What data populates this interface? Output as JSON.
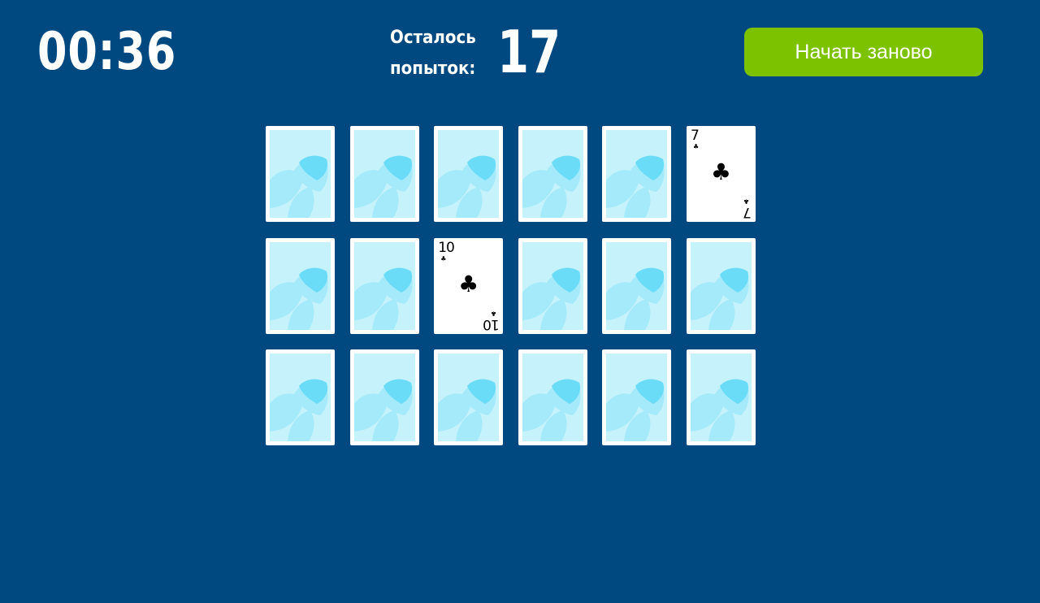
{
  "header": {
    "timer": "00:36",
    "attempts_label": "Осталось попыток:",
    "attempts_count": "17",
    "restart_label": "Начать заново"
  },
  "colors": {
    "background": "#004980",
    "button": "#7dc200",
    "card_back": "#c5f2fb",
    "card_back_leaf_light": "#a4eafa",
    "card_back_leaf_dark": "#6bdcf8"
  },
  "board": {
    "rows": 3,
    "columns": 6,
    "cards": [
      {
        "state": "back",
        "icon": "leaf-pattern-icon"
      },
      {
        "state": "back",
        "icon": "leaf-pattern-icon"
      },
      {
        "state": "back",
        "icon": "leaf-pattern-icon"
      },
      {
        "state": "back",
        "icon": "leaf-pattern-icon"
      },
      {
        "state": "back",
        "icon": "leaf-pattern-icon"
      },
      {
        "state": "face",
        "rank": "7",
        "suit": "♣",
        "suit_name": "clubs-icon"
      },
      {
        "state": "back",
        "icon": "leaf-pattern-icon"
      },
      {
        "state": "back",
        "icon": "leaf-pattern-icon"
      },
      {
        "state": "face",
        "rank": "10",
        "suit": "♣",
        "suit_name": "clubs-icon"
      },
      {
        "state": "back",
        "icon": "leaf-pattern-icon"
      },
      {
        "state": "back",
        "icon": "leaf-pattern-icon"
      },
      {
        "state": "back",
        "icon": "leaf-pattern-icon"
      },
      {
        "state": "back",
        "icon": "leaf-pattern-icon"
      },
      {
        "state": "back",
        "icon": "leaf-pattern-icon"
      },
      {
        "state": "back",
        "icon": "leaf-pattern-icon"
      },
      {
        "state": "back",
        "icon": "leaf-pattern-icon"
      },
      {
        "state": "back",
        "icon": "leaf-pattern-icon"
      },
      {
        "state": "back",
        "icon": "leaf-pattern-icon"
      }
    ]
  }
}
